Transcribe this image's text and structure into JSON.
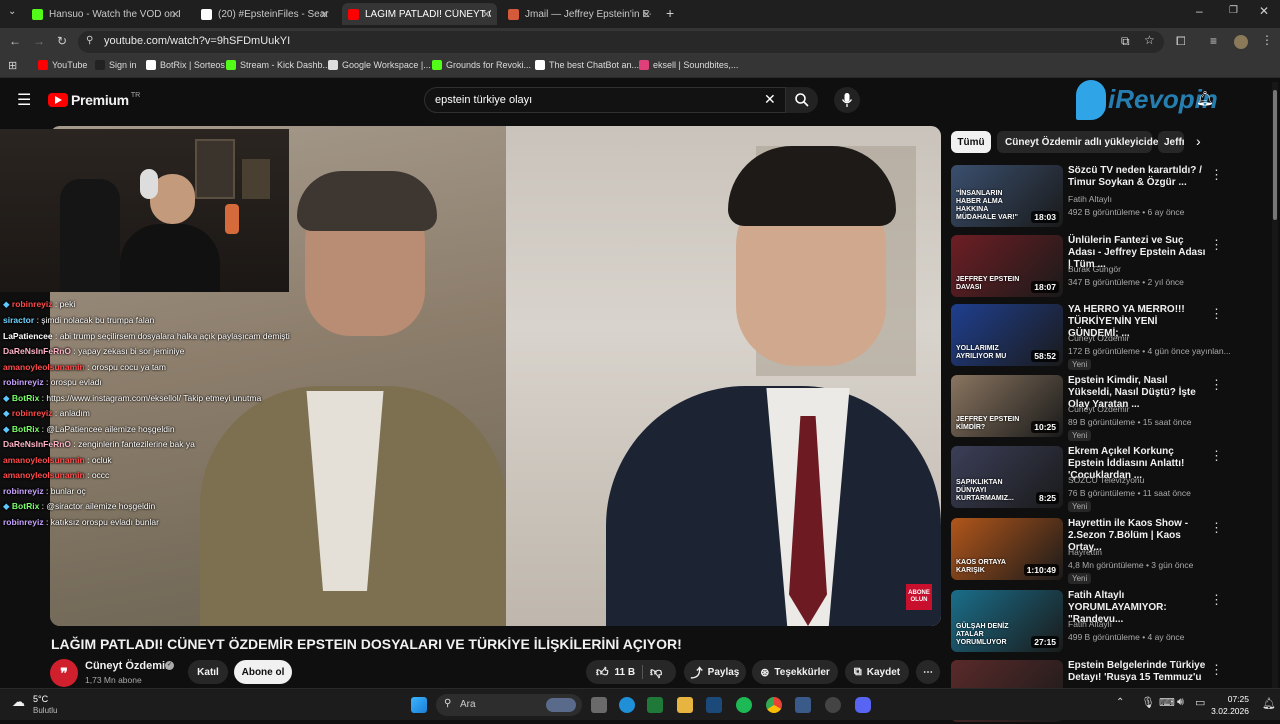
{
  "browser": {
    "tabs": [
      {
        "label": "Hansuo - Watch the VOD on Ki",
        "icon": "kick-icon",
        "color": "#53fc18"
      },
      {
        "label": "(20) #EpsteinFiles - Search / X",
        "icon": "x-icon",
        "color": "#ffffff"
      },
      {
        "label": "LAĞIM PATLADI! CÜNEYT Ö",
        "icon": "youtube-icon",
        "color": "#ff0000"
      },
      {
        "label": "Jmail — Jeffrey Epstein'in E-po",
        "icon": "mail-icon",
        "color": "#d45a3a"
      }
    ],
    "url": "youtube.com/watch?v=9hSFDmUukYI",
    "bookmarks": [
      "YouTube",
      "Sign in",
      "BotRix | Sorteos",
      "Stream - Kick Dashb...",
      "Google Workspace |...",
      "Grounds for Revoki...",
      "The best ChatBot an...",
      "eksell | Soundbites,..."
    ]
  },
  "youtube": {
    "logo_label": "Premium",
    "logo_sup": "TR",
    "search_value": "epstein türkiye olayı",
    "watermark": "iRevopin",
    "video": {
      "title": "LAĞIM PATLADI! CÜNEYT ÖZDEMİR EPSTEIN DOSYALARI VE TÜRKİYE İLİŞKİLERİNİ AÇIYOR!",
      "channel": "Cüneyt Özdemir",
      "subs": "1,73 Mn abone",
      "join": "Katıl",
      "subscribe": "Abone ol",
      "likes": "11 B",
      "share": "Paylaş",
      "thanks": "Teşekkürler",
      "save": "Kaydet",
      "overlay_badge": "ABONE OLUN"
    },
    "chips": [
      "Tümü",
      "Cüneyt Özdemir adlı yükleyiciden",
      "Jeffr"
    ],
    "recommendations": [
      {
        "title": "Sözcü TV neden karartıldı? / Timur Soykan & Özgür ...",
        "channel": "Fatih Altaylı",
        "meta": "492 B görüntüleme • 6 ay önce",
        "badge": "",
        "duration": "18:03",
        "thumb_text": "\"İNSANLARIN HABER ALMA HAKKINA MÜDAHALE VAR!\"",
        "thumb_color": "#3a4f6e"
      },
      {
        "title": "Ünlülerin Fantezi ve Suç Adası - Jeffrey Epstein Adası | Tüm ...",
        "channel": "Burak Güngör",
        "meta": "347 B görüntüleme • 2 yıl önce",
        "badge": "",
        "duration": "18:07",
        "thumb_text": "JEFFREY EPSTEIN DAVASI",
        "thumb_color": "#6e1e24"
      },
      {
        "title": "YA HERRO YA MERRO!!! TÜRKİYE'NİN YENİ GÜNDEMİ; ...",
        "channel": "Cüneyt Özdemir",
        "meta": "172 B görüntüleme • 4 gün önce yayınlan...",
        "badge": "Yeni",
        "duration": "58:52",
        "thumb_text": "YOLLARIMIZ AYRILIYOR MU",
        "thumb_color": "#1f3f8f"
      },
      {
        "title": "Epstein Kimdir, Nasıl Yükseldi, Nasıl Düştü? İşte Olay Yaratan ...",
        "channel": "Cüneyt Özdemir",
        "meta": "89 B görüntüleme • 15 saat önce",
        "badge": "Yeni",
        "duration": "10:25",
        "thumb_text": "JEFFREY EPSTEIN KİMDİR?",
        "thumb_color": "#8a7560"
      },
      {
        "title": "Ekrem Açıkel Korkunç Epstein İddiasını Anlattı! 'Çocuklardan ...",
        "channel": "SÖZCÜ Televizyonu",
        "meta": "76 B görüntüleme • 11 saat önce",
        "badge": "Yeni",
        "duration": "8:25",
        "thumb_text": "SAPIKLIKTAN DÜNYAYI KURTARMAMIZ...",
        "thumb_color": "#3b3f58"
      },
      {
        "title": "Hayrettin ile Kaos Show - 2.Sezon 7.Bölüm | Kaos Ortay...",
        "channel": "Hayrettin",
        "meta": "4,8 Mn görüntüleme • 3 gün önce",
        "badge": "Yeni",
        "duration": "1:10:49",
        "thumb_text": "KAOS ORTAYA KARIŞIK",
        "thumb_color": "#b2561a"
      },
      {
        "title": "Fatih Altaylı YORUMLAYAMIYOR: \"Randevu...",
        "channel": "Fatih Altaylı",
        "meta": "499 B görüntüleme • 4 ay önce",
        "badge": "",
        "duration": "27:15",
        "thumb_text": "GÜLŞAH DENİZ ATALAR YORUMLUYOR",
        "thumb_color": "#1a6e8a"
      },
      {
        "title": "Epstein Belgelerinde Türkiye Detayı! 'Rusya 15 Temmuz'u ...",
        "channel": "",
        "meta": "",
        "badge": "",
        "duration": "",
        "thumb_text": "",
        "thumb_color": "#5a2a2a"
      }
    ]
  },
  "chat": [
    {
      "user": "robinreyiz",
      "color": "#ff4b4b",
      "msg": ": peki",
      "badges": true
    },
    {
      "user": "siractor",
      "color": "#6fd3ff",
      "msg": ": şimdi nolacak bu trumpa falan",
      "badges": false
    },
    {
      "user": "LaPatiencee",
      "color": "#ffffff",
      "msg": ": abi trump seçilirsem dosyalara halka açık paylaşıcam demişti",
      "badges": false
    },
    {
      "user": "DaReNsInFeRnO",
      "color": "#ffb3c6",
      "msg": ": yapay zekası bi sor jeminiye",
      "badges": false
    },
    {
      "user": "amanoyleolsunamin",
      "color": "#ff4b4b",
      "msg": ": orospu cocu ya tam",
      "badges": false
    },
    {
      "user": "robinreyiz",
      "color": "#c8a2ff",
      "msg": ": orospu evladı",
      "badges": false
    },
    {
      "user": "BotRix",
      "color": "#7cff6b",
      "msg": ": https://www.instagram.com/eksellol/ Takip etmeyi unutma",
      "badges": true
    },
    {
      "user": "robinreyiz",
      "color": "#ff4b4b",
      "msg": ": anladım",
      "badges": true
    },
    {
      "user": "BotRix",
      "color": "#7cff6b",
      "msg": ": @LaPatiencee ailemize hoşgeldin",
      "badges": true
    },
    {
      "user": "DaReNsInFeRnO",
      "color": "#ffb3c6",
      "msg": ": zenginlerin fantezilerine bak ya",
      "badges": false
    },
    {
      "user": "amanoyleolsunamin",
      "color": "#ff4b4b",
      "msg": ": ocluk",
      "badges": false
    },
    {
      "user": "amanoyleolsunamin",
      "color": "#ff4b4b",
      "msg": ": occc",
      "badges": false
    },
    {
      "user": "robinreyiz",
      "color": "#c8a2ff",
      "msg": ": bunlar oç",
      "badges": false
    },
    {
      "user": "BotRix",
      "color": "#7cff6b",
      "msg": ": @siractor ailemize hoşgeldin",
      "badges": true
    },
    {
      "user": "robinreyiz",
      "color": "#c8a2ff",
      "msg": ": katıksız orospu evladı bunlar",
      "badges": false
    }
  ],
  "taskbar": {
    "weather_temp": "5°C",
    "weather_desc": "Bulutlu",
    "search_placeholder": "Ara",
    "time": "07:25",
    "date": "3.02.2026"
  }
}
